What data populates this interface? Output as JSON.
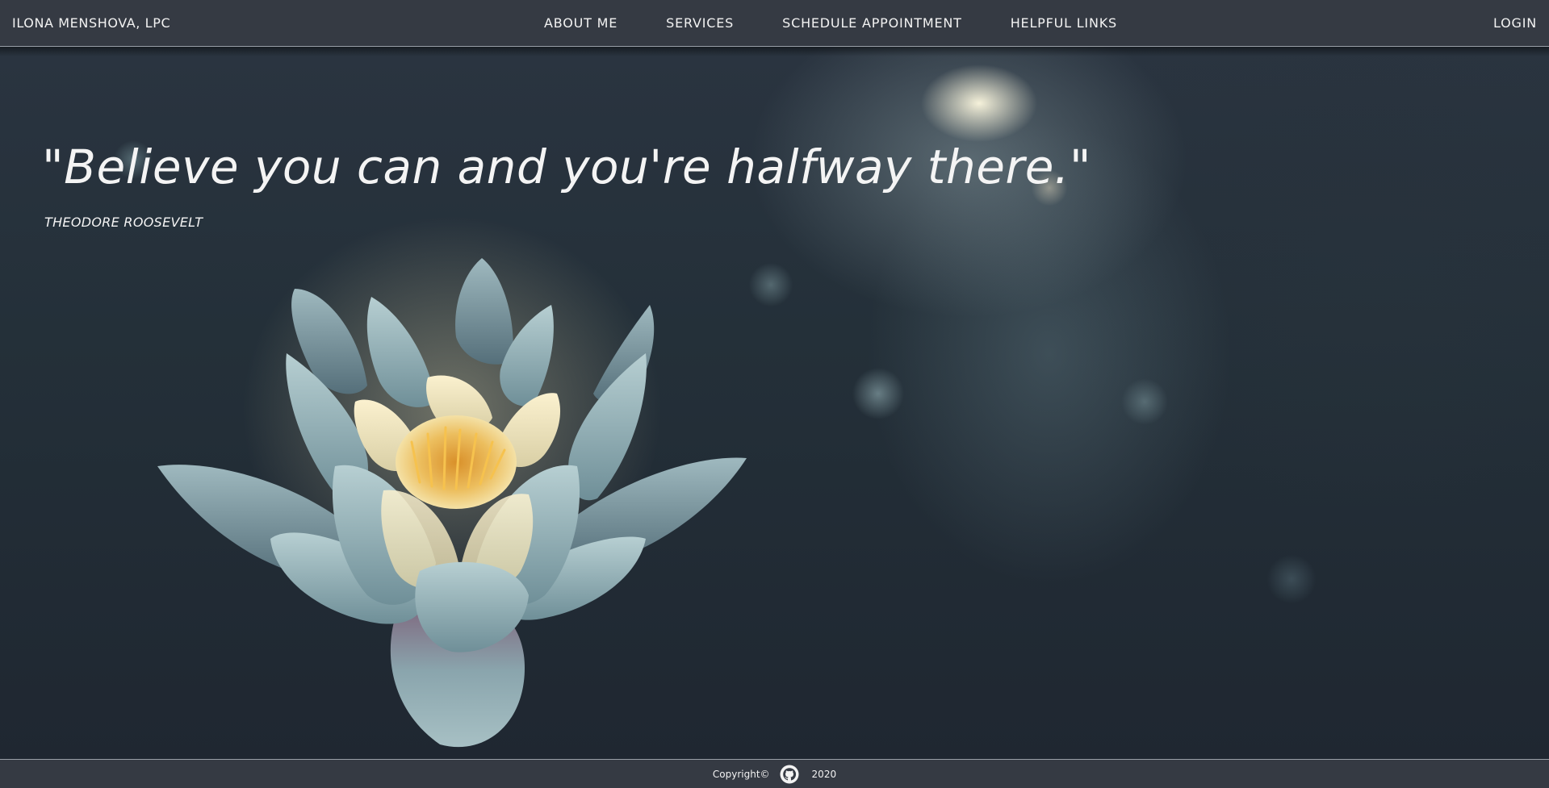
{
  "header": {
    "brand": "ILONA MENSHOVA, LPC",
    "nav": [
      {
        "label": "ABOUT ME"
      },
      {
        "label": "SERVICES"
      },
      {
        "label": "SCHEDULE APPOINTMENT"
      },
      {
        "label": "HELPFUL LINKS"
      }
    ],
    "login": "LOGIN"
  },
  "hero": {
    "quote": "\"Believe you can and you're halfway there.\"",
    "author": "THEODORE ROOSEVELT",
    "background_image": "lotus-flower-bokeh"
  },
  "footer": {
    "copyright": "Copyright©",
    "icon": "github-icon",
    "year": "2020"
  },
  "colors": {
    "navbar": "#353a43",
    "text": "#f2f2f2",
    "hero_dark": "#1f2731",
    "petal": "#8fb0b6",
    "petal_center": "#f0dfa8",
    "stamens": "#e8a53c"
  }
}
